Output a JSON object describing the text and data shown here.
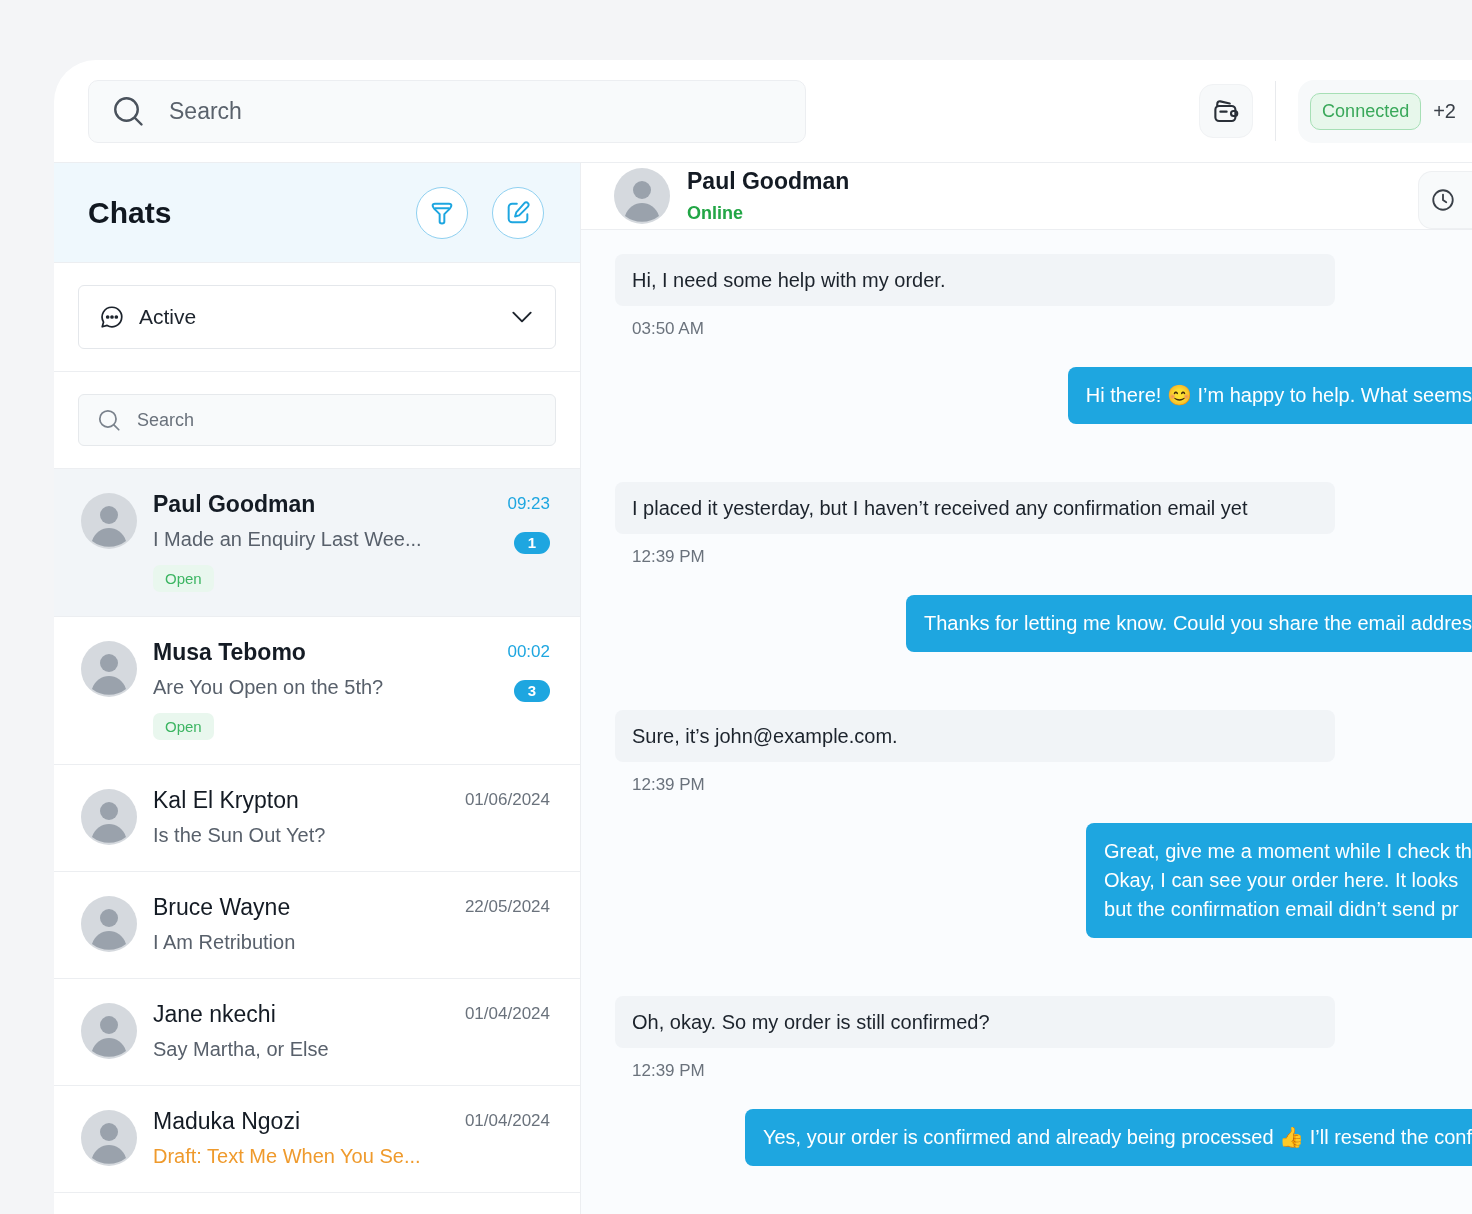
{
  "topbar": {
    "search": {
      "placeholder": "Search"
    },
    "status": {
      "badge": "Connected",
      "phone": "+2"
    }
  },
  "sidebar": {
    "title": "Chats",
    "filter": {
      "label": "Active"
    },
    "search": {
      "placeholder": "Search"
    },
    "chats": [
      {
        "name": "Paul Goodman",
        "preview": "I Made an Enquiry Last Wee...",
        "time": "09:23",
        "unread": "1",
        "tag": "Open",
        "selected": true,
        "draft": false
      },
      {
        "name": "Musa Tebomo",
        "preview": "Are You Open on the 5th?",
        "time": "00:02",
        "unread": "3",
        "tag": "Open",
        "selected": false,
        "draft": false
      },
      {
        "name": "Kal El Krypton",
        "preview": "Is the Sun Out Yet?",
        "time": "01/06/2024",
        "selected": false,
        "draft": false
      },
      {
        "name": "Bruce Wayne",
        "preview": "I Am Retribution",
        "time": "22/05/2024",
        "selected": false,
        "draft": false
      },
      {
        "name": "Jane nkechi",
        "preview": "Say Martha, or Else",
        "time": "01/04/2024",
        "selected": false,
        "draft": false
      },
      {
        "name": "Maduka Ngozi",
        "preview": "Draft: Text Me When You Se...",
        "time": "01/04/2024",
        "selected": false,
        "draft": true
      }
    ]
  },
  "conversation": {
    "contact": {
      "name": "Paul Goodman",
      "status": "Online"
    },
    "messages": [
      {
        "kind": "in",
        "text": "Hi, I need some help with my order.",
        "time": "03:50 AM"
      },
      {
        "kind": "out",
        "text": "Hi there! 😊 I’m happy to help. What seems"
      },
      {
        "kind": "in",
        "text": "I placed it yesterday, but I haven’t received any confirmation email yet",
        "time": "12:39 PM"
      },
      {
        "kind": "out",
        "text": "Thanks for letting me know. Could you share the email addres"
      },
      {
        "kind": "in",
        "text": "Sure, it’s john@example.com.",
        "time": "12:39 PM"
      },
      {
        "kind": "out",
        "text": "Great, give me a moment while I check th\nOkay, I can see your order here. It looks\nbut the confirmation email didn’t send pr"
      },
      {
        "kind": "in",
        "text": "Oh, okay. So my order is still confirmed?",
        "time": "12:39 PM"
      },
      {
        "kind": "out",
        "text": "Yes, your order is confirmed and already being processed 👍 I’ll resend the conf"
      }
    ]
  }
}
